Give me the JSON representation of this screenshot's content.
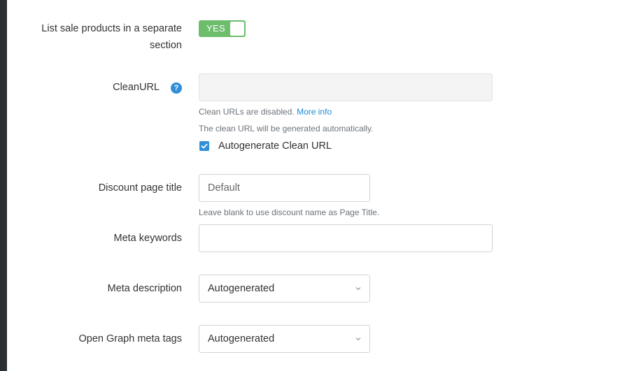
{
  "sale_products": {
    "label_line1": "List sale products in a separate",
    "label_line2": "section",
    "toggle_text": "YES"
  },
  "clean_url": {
    "label": "CleanURL",
    "help_glyph": "?",
    "value": "",
    "disabled_text": "Clean URLs are disabled.",
    "more_info": "More info",
    "auto_note": "The clean URL will be generated automatically.",
    "autogenerate_label": "Autogenerate Clean URL",
    "autogenerate_checked": true
  },
  "discount_title": {
    "label": "Discount page title",
    "placeholder": "Default",
    "hint": "Leave blank to use discount name as Page Title."
  },
  "meta_keywords": {
    "label": "Meta keywords",
    "value": ""
  },
  "meta_description": {
    "label": "Meta description",
    "selected": "Autogenerated"
  },
  "og_tags": {
    "label": "Open Graph meta tags",
    "selected": "Autogenerated"
  },
  "colors": {
    "toggle_green": "#6dbd6d",
    "accent_blue": "#2f8fd6",
    "link_blue": "#1f8dd6",
    "sidebar_dark": "#2b3035"
  },
  "icons": {
    "help": "question-circle-icon",
    "check": "check-icon",
    "chevron": "chevron-down-icon"
  }
}
